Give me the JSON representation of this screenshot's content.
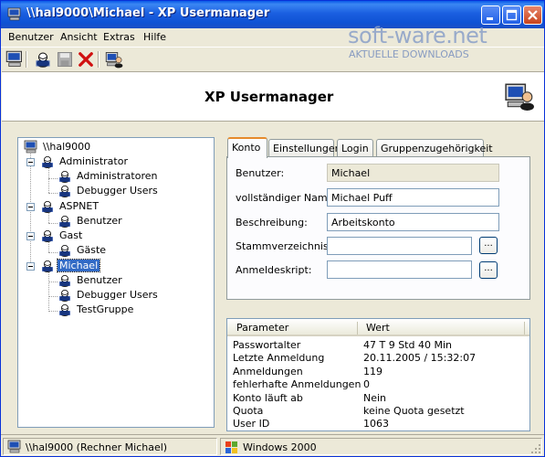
{
  "window": {
    "title": "\\\\hal9000\\Michael - XP Usermanager"
  },
  "menu": [
    {
      "label": "Benutzer"
    },
    {
      "label": "Ansicht"
    },
    {
      "label": "Extras"
    },
    {
      "label": "Hilfe"
    }
  ],
  "toolbar": {
    "icons": [
      "computer-icon",
      "user-icon",
      "save-icon",
      "delete-icon",
      "users-icon"
    ]
  },
  "watermark": {
    "logo": "soft-ware.net",
    "tagline": "AKTUELLE DOWNLOADS"
  },
  "banner": {
    "title": "XP Usermanager"
  },
  "tree": {
    "root": "\\\\hal9000",
    "users": [
      {
        "name": "Administrator",
        "groups": [
          "Administratoren",
          "Debugger Users"
        ]
      },
      {
        "name": "ASPNET",
        "groups": [
          "Benutzer"
        ]
      },
      {
        "name": "Gast",
        "groups": [
          "Gäste"
        ]
      },
      {
        "name": "Michael",
        "groups": [
          "Benutzer",
          "Debugger Users",
          "TestGruppe"
        ],
        "selected": true
      }
    ]
  },
  "tabs": [
    {
      "label": "Konto",
      "active": true
    },
    {
      "label": "Einstellungen"
    },
    {
      "label": "Login"
    },
    {
      "label": "Gruppenzugehörigkeit"
    }
  ],
  "form": {
    "benutzer_label": "Benutzer:",
    "benutzer_value": "Michael",
    "fullname_label": "vollständiger Name:",
    "fullname_value": "Michael Puff",
    "desc_label": "Beschreibung:",
    "desc_value": "Arbeitskonto",
    "homedir_label": "Stammverzeichnis:",
    "homedir_value": "",
    "logon_label": "Anmeldeskript:",
    "logon_value": "",
    "browse_label": "..."
  },
  "details": {
    "columns": [
      "Parameter",
      "Wert"
    ],
    "rows": [
      [
        "Passwortalter",
        "47 T 9 Std 40 Min"
      ],
      [
        "Letzte Anmeldung",
        "20.11.2005 / 15:32:07"
      ],
      [
        "Anmeldungen",
        "119"
      ],
      [
        "fehlerhafte Anmeldungen",
        "0"
      ],
      [
        "Konto läuft ab",
        "Nein"
      ],
      [
        "Quota",
        "keine Quota gesetzt"
      ],
      [
        "User ID",
        "1063"
      ]
    ]
  },
  "status": {
    "machine": "\\\\hal9000 (Rechner Michael)",
    "os": "Windows 2000"
  },
  "colors": {
    "titlebar": "#0a58e8",
    "selection": "#316ac5",
    "tab_accent": "#e68b2c"
  }
}
